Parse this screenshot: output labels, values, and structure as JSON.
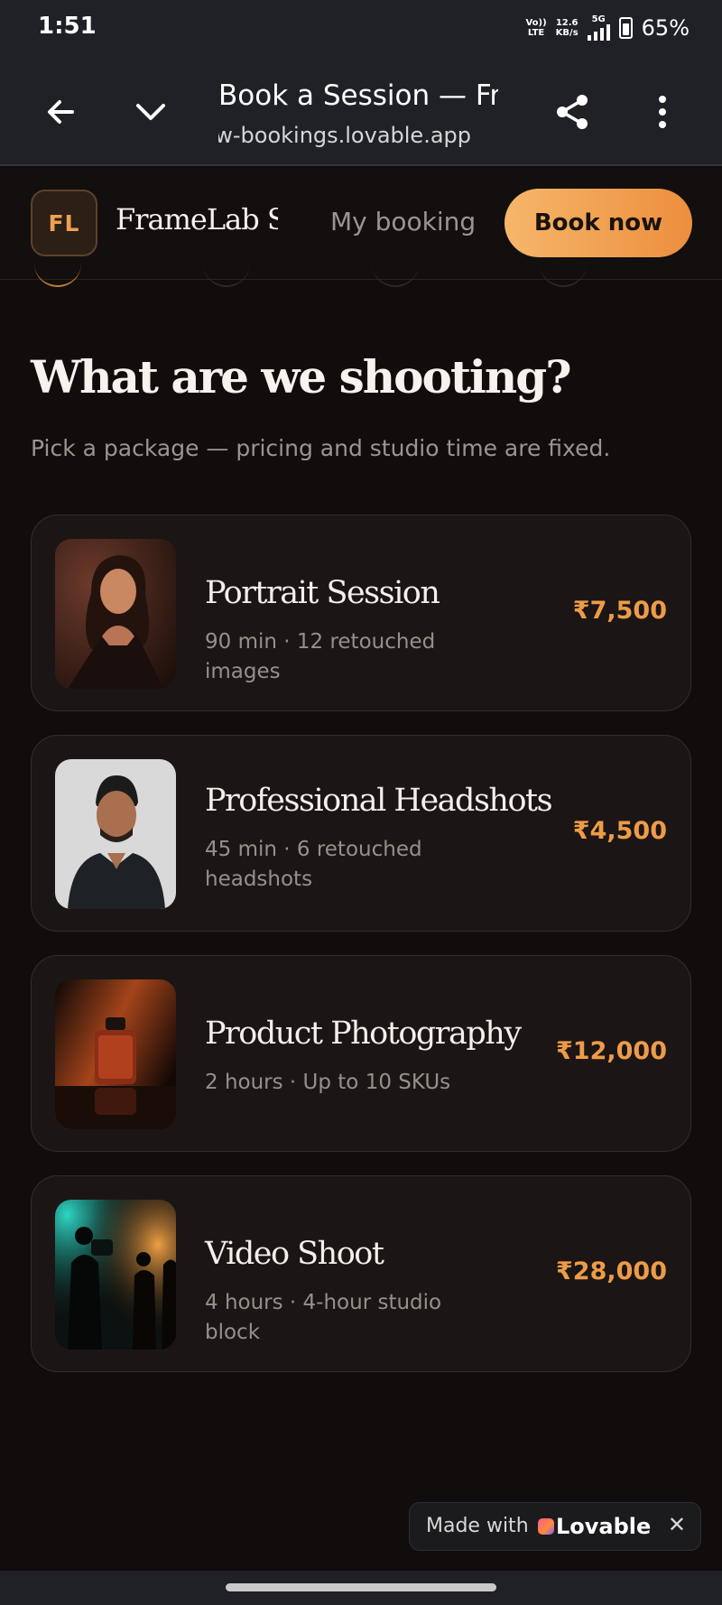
{
  "status_bar": {
    "time": "1:51",
    "volte_top": "Vo))",
    "volte_bottom": "LTE",
    "speed_value": "12.6",
    "speed_unit": "KB/s",
    "network": "5G",
    "battery": "65%"
  },
  "browser": {
    "title": "Book a Session — Fr...",
    "url": "ow-bookings.lovable.app",
    "back_icon": "arrow-left-icon",
    "collapse_icon": "chevron-down-icon",
    "share_icon": "share-icon",
    "menu_icon": "more-vertical-icon"
  },
  "header": {
    "logo": "FL",
    "brand": "FrameLab St...",
    "my_booking": "My booking",
    "book_now": "Book now"
  },
  "page": {
    "heading": "What are we shooting?",
    "subheading": "Pick a package — pricing and studio time are fixed."
  },
  "packages": [
    {
      "title": "Portrait Session",
      "desc": "90 min · 12 retouched images",
      "price": "₹7,500"
    },
    {
      "title": "Professional Headshots",
      "desc": "45 min · 6 retouched headshots",
      "price": "₹4,500"
    },
    {
      "title": "Product Photography",
      "desc": "2 hours · Up to 10 SKUs",
      "price": "₹12,000"
    },
    {
      "title": "Video Shoot",
      "desc": "4 hours · 4-hour studio block",
      "price": "₹28,000"
    }
  ],
  "footer": {
    "made_with": "Made with",
    "brand": "Lovable",
    "close": "✕"
  },
  "colors": {
    "accent": "#ee9b48",
    "background": "#110d0c",
    "card": "#1b1615"
  }
}
